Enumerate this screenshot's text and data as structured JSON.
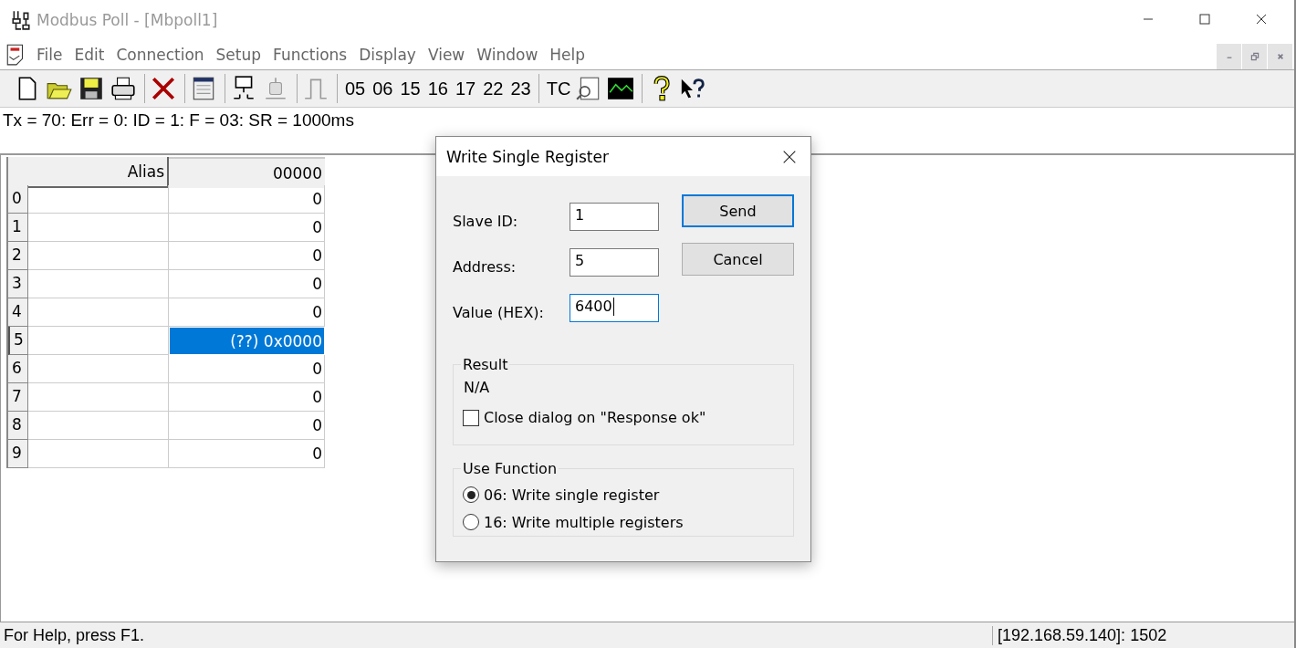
{
  "window": {
    "title": "Modbus Poll - [Mbpoll1]"
  },
  "menu": [
    "File",
    "Edit",
    "Connection",
    "Setup",
    "Functions",
    "Display",
    "View",
    "Window",
    "Help"
  ],
  "toolbar_functions": [
    "05",
    "06",
    "15",
    "16",
    "17",
    "22",
    "23"
  ],
  "toolbar_tc": "TC",
  "poll_status": "Tx = 70: Err = 0: ID = 1: F = 03: SR = 1000ms",
  "table": {
    "columns": [
      "Alias",
      "00000"
    ],
    "rows": [
      {
        "header": "0",
        "value": "0",
        "selected": false
      },
      {
        "header": "1",
        "value": "0",
        "selected": false
      },
      {
        "header": "2",
        "value": "0",
        "selected": false
      },
      {
        "header": "3",
        "value": "0",
        "selected": false
      },
      {
        "header": "4",
        "value": "0",
        "selected": false
      },
      {
        "header": "5",
        "value": "(??) 0x0000",
        "selected": true
      },
      {
        "header": "6",
        "value": "0",
        "selected": false
      },
      {
        "header": "7",
        "value": "0",
        "selected": false
      },
      {
        "header": "8",
        "value": "0",
        "selected": false
      },
      {
        "header": "9",
        "value": "0",
        "selected": false
      }
    ]
  },
  "dialog": {
    "title": "Write Single Register",
    "fields": [
      {
        "label": "Slave ID:",
        "value": "1",
        "focused": false
      },
      {
        "label": "Address:",
        "value": "5",
        "focused": false
      },
      {
        "label": "Value (HEX):",
        "value": "6400",
        "focused": true
      }
    ],
    "buttons": [
      {
        "label": "Send",
        "default": true
      },
      {
        "label": "Cancel",
        "default": false
      }
    ],
    "result": {
      "title": "Result",
      "text": "N/A",
      "checkbox": {
        "label": "Close dialog on \"Response ok\"",
        "checked": false
      }
    },
    "use_function": {
      "title": "Use Function",
      "options": [
        {
          "label": "06: Write single register",
          "selected": true
        },
        {
          "label": "16: Write multiple registers",
          "selected": false
        }
      ]
    }
  },
  "status_bar": {
    "help": "For Help, press F1.",
    "connection": "[192.168.59.140]: 1502"
  }
}
